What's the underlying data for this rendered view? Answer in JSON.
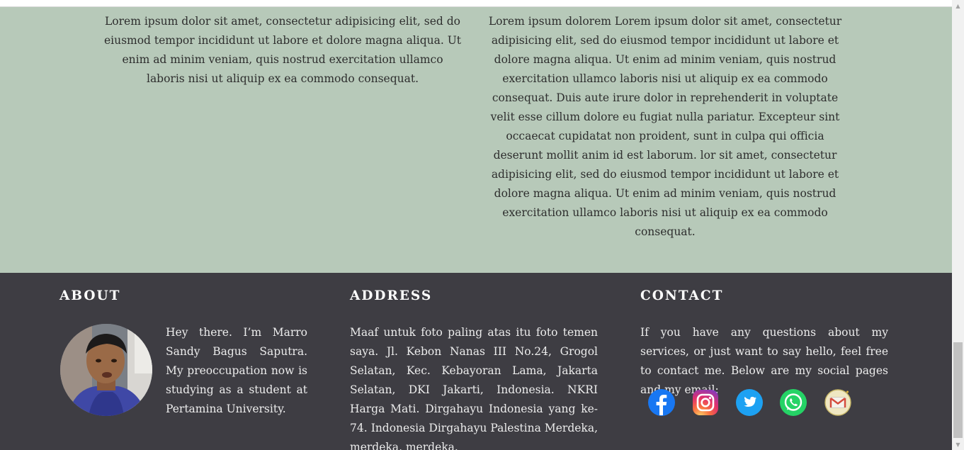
{
  "content": {
    "left_paragraph": "Lorem ipsum dolor sit amet, consectetur adipisicing elit, sed do eiusmod tempor incididunt ut labore et dolore magna aliqua. Ut enim ad minim veniam, quis nostrud exercitation ullamco laboris nisi ut aliquip ex ea commodo consequat.",
    "right_paragraph": "Lorem ipsum dolorem Lorem ipsum dolor sit amet, consectetur adipisicing elit, sed do eiusmod tempor incididunt ut labore et dolore magna aliqua. Ut enim ad minim veniam, quis nostrud exercitation ullamco laboris nisi ut aliquip ex ea commodo consequat. Duis aute irure dolor in reprehenderit in voluptate velit esse cillum dolore eu fugiat nulla pariatur. Excepteur sint occaecat cupidatat non proident, sunt in culpa qui officia deserunt mollit anim id est laborum. lor sit amet, consectetur adipisicing elit, sed do eiusmod tempor incididunt ut labore et dolore magna aliqua. Ut enim ad minim veniam, quis nostrud exercitation ullamco laboris nisi ut aliquip ex ea commodo consequat."
  },
  "footer": {
    "about": {
      "heading": "ABOUT",
      "text": "Hey there. I’m Marro Sandy Bagus Saputra. My preoccupation now is studying as a student at Pertamina University."
    },
    "address": {
      "heading": "ADDRESS",
      "text": "Maaf untuk foto paling atas itu foto temen saya. Jl. Kebon Nanas III No.24, Grogol Selatan, Kec. Kebayoran Lama, Jakarta Selatan, DKI Jakarti, Indonesia. NKRI Harga Mati. Dirgahayu Indonesia yang ke-74. Indonesia Dirgahayu Palestina Merdeka, merdeka, merdeka."
    },
    "contact": {
      "heading": "CONTACT",
      "text": "If you have any questions about my services, or just want to say hello, feel free to contact me. Below are my social pages and my email:",
      "social_icons": [
        "facebook-icon",
        "instagram-icon",
        "twitter-icon",
        "whatsapp-icon",
        "gmail-icon"
      ]
    }
  },
  "colors": {
    "content_bg": "#b7c9b9",
    "footer_bg": "#3e3d43",
    "facebook": "#1877f2",
    "twitter": "#1da1f2",
    "whatsapp": "#25d366"
  }
}
